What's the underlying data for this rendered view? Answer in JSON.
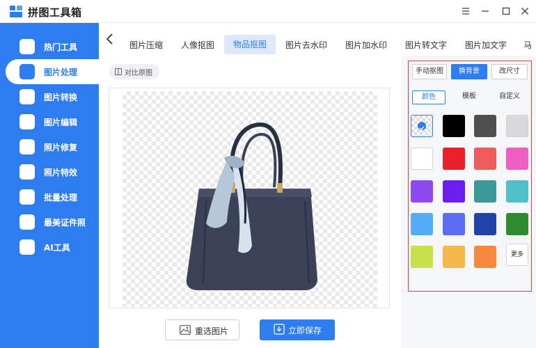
{
  "app": {
    "title": "拼图工具箱"
  },
  "sidebar": {
    "items": [
      {
        "label": "热门工具",
        "icon": "hot-tools-icon"
      },
      {
        "label": "图片处理",
        "icon": "image-process-icon"
      },
      {
        "label": "图片转换",
        "icon": "image-convert-icon"
      },
      {
        "label": "图片编辑",
        "icon": "image-edit-icon"
      },
      {
        "label": "照片修复",
        "icon": "photo-repair-icon"
      },
      {
        "label": "照片特效",
        "icon": "photo-effect-icon"
      },
      {
        "label": "批量处理",
        "icon": "batch-process-icon"
      },
      {
        "label": "最美证件照",
        "icon": "id-photo-icon"
      },
      {
        "label": "AI工具",
        "icon": "ai-tools-icon"
      }
    ]
  },
  "tabs": [
    "图片压缩",
    "人像抠图",
    "物品抠图",
    "图片去水印",
    "图片加水印",
    "图片转文字",
    "图片加文字",
    "马"
  ],
  "active_tab": "物品抠图",
  "compare_label": "对比原图",
  "buttons": {
    "reselect": "重选图片",
    "save": "立即保存"
  },
  "panel": {
    "modes": [
      "手动抠图",
      "换背景",
      "改尺寸"
    ],
    "active_mode": "换背景",
    "subtabs": [
      "颜色",
      "模板",
      "自定义"
    ],
    "active_subtab": "颜色",
    "colors": [
      "transparent",
      "#000000",
      "#4f4f4f",
      "#d9d9d9",
      "#ffffff",
      "#e8202a",
      "#ef5a5a",
      "#ef5ec2",
      "#8c4af0",
      "#6a1ef0",
      "#3a9a9a",
      "#4fc0c8",
      "#55acf5",
      "#5b6cf5",
      "#2142a8",
      "#2e8b2e",
      "#c8e04a",
      "#f5b84a",
      "#f58a3e"
    ],
    "more_label": "更多"
  }
}
